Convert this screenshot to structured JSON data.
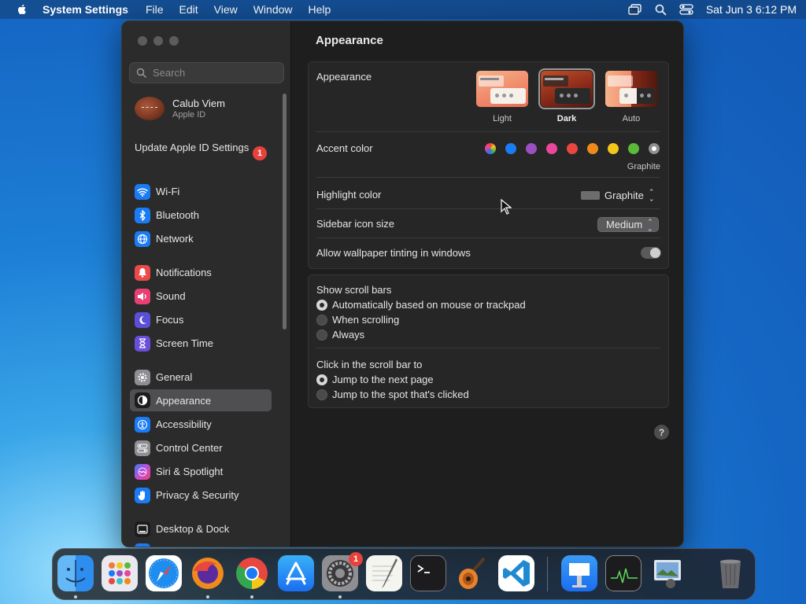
{
  "menubar": {
    "app_name": "System Settings",
    "menus": [
      "File",
      "Edit",
      "View",
      "Window",
      "Help"
    ],
    "datetime": "Sat Jun 3  6:12 PM"
  },
  "sidebar": {
    "search_placeholder": "Search",
    "apple_id": {
      "name": "Calub Viem",
      "subtitle": "Apple ID"
    },
    "update": {
      "label": "Update Apple ID Settings",
      "badge": "1"
    },
    "items": [
      {
        "label": "Wi-Fi",
        "icon": "wifi-icon",
        "color": "#1a7cf5"
      },
      {
        "label": "Bluetooth",
        "icon": "bluetooth-icon",
        "color": "#1a7cf5"
      },
      {
        "label": "Network",
        "icon": "globe-icon",
        "color": "#1a7cf5"
      },
      {
        "label": "Notifications",
        "icon": "bell-icon",
        "color": "#ea4a4a"
      },
      {
        "label": "Sound",
        "icon": "speaker-icon",
        "color": "#ea3f75"
      },
      {
        "label": "Focus",
        "icon": "moon-icon",
        "color": "#5b4fd8"
      },
      {
        "label": "Screen Time",
        "icon": "hourglass-icon",
        "color": "#6a4fd8"
      },
      {
        "label": "General",
        "icon": "gear-icon",
        "color": "#8e8e93"
      },
      {
        "label": "Appearance",
        "icon": "appearance-icon",
        "color": "#1c1c1e"
      },
      {
        "label": "Accessibility",
        "icon": "accessibility-icon",
        "color": "#1a7cf5"
      },
      {
        "label": "Control Center",
        "icon": "control-center-icon",
        "color": "#8e8e93"
      },
      {
        "label": "Siri & Spotlight",
        "icon": "siri-icon",
        "color": "#b84fd8"
      },
      {
        "label": "Privacy & Security",
        "icon": "hand-icon",
        "color": "#1a7cf5"
      },
      {
        "label": "Desktop & Dock",
        "icon": "dock-icon",
        "color": "#1c1c1e"
      }
    ],
    "selected": "Appearance"
  },
  "content": {
    "title": "Appearance",
    "appearance": {
      "label": "Appearance",
      "options": [
        "Light",
        "Dark",
        "Auto"
      ],
      "selected": "Dark"
    },
    "accent": {
      "label": "Accent color",
      "colors": [
        "multicolor",
        "#1a7cf5",
        "#9b4fc0",
        "#e8479a",
        "#e8473f",
        "#f08a1c",
        "#f4c61c",
        "#5cba3a",
        "#8e8e93"
      ],
      "selected_name": "Graphite"
    },
    "highlight": {
      "label": "Highlight color",
      "value": "Graphite"
    },
    "sidebar_icon_size": {
      "label": "Sidebar icon size",
      "value": "Medium"
    },
    "tinting": {
      "label": "Allow wallpaper tinting in windows",
      "enabled": false
    },
    "scroll_bars": {
      "title": "Show scroll bars",
      "options": [
        "Automatically based on mouse or trackpad",
        "When scrolling",
        "Always"
      ],
      "selected": 0
    },
    "click_scroll": {
      "title": "Click in the scroll bar to",
      "options": [
        "Jump to the next page",
        "Jump to the spot that's clicked"
      ],
      "selected": 0
    },
    "help": "?"
  },
  "dock": {
    "apps": [
      "Finder",
      "Launchpad",
      "Safari",
      "Firefox",
      "Chrome",
      "App Store",
      "System Settings",
      "TextEdit",
      "Terminal",
      "GarageBand",
      "Visual Studio Code",
      "Keynote",
      "Activity Monitor",
      "Preview",
      "Trash"
    ],
    "settings_badge": "1"
  }
}
